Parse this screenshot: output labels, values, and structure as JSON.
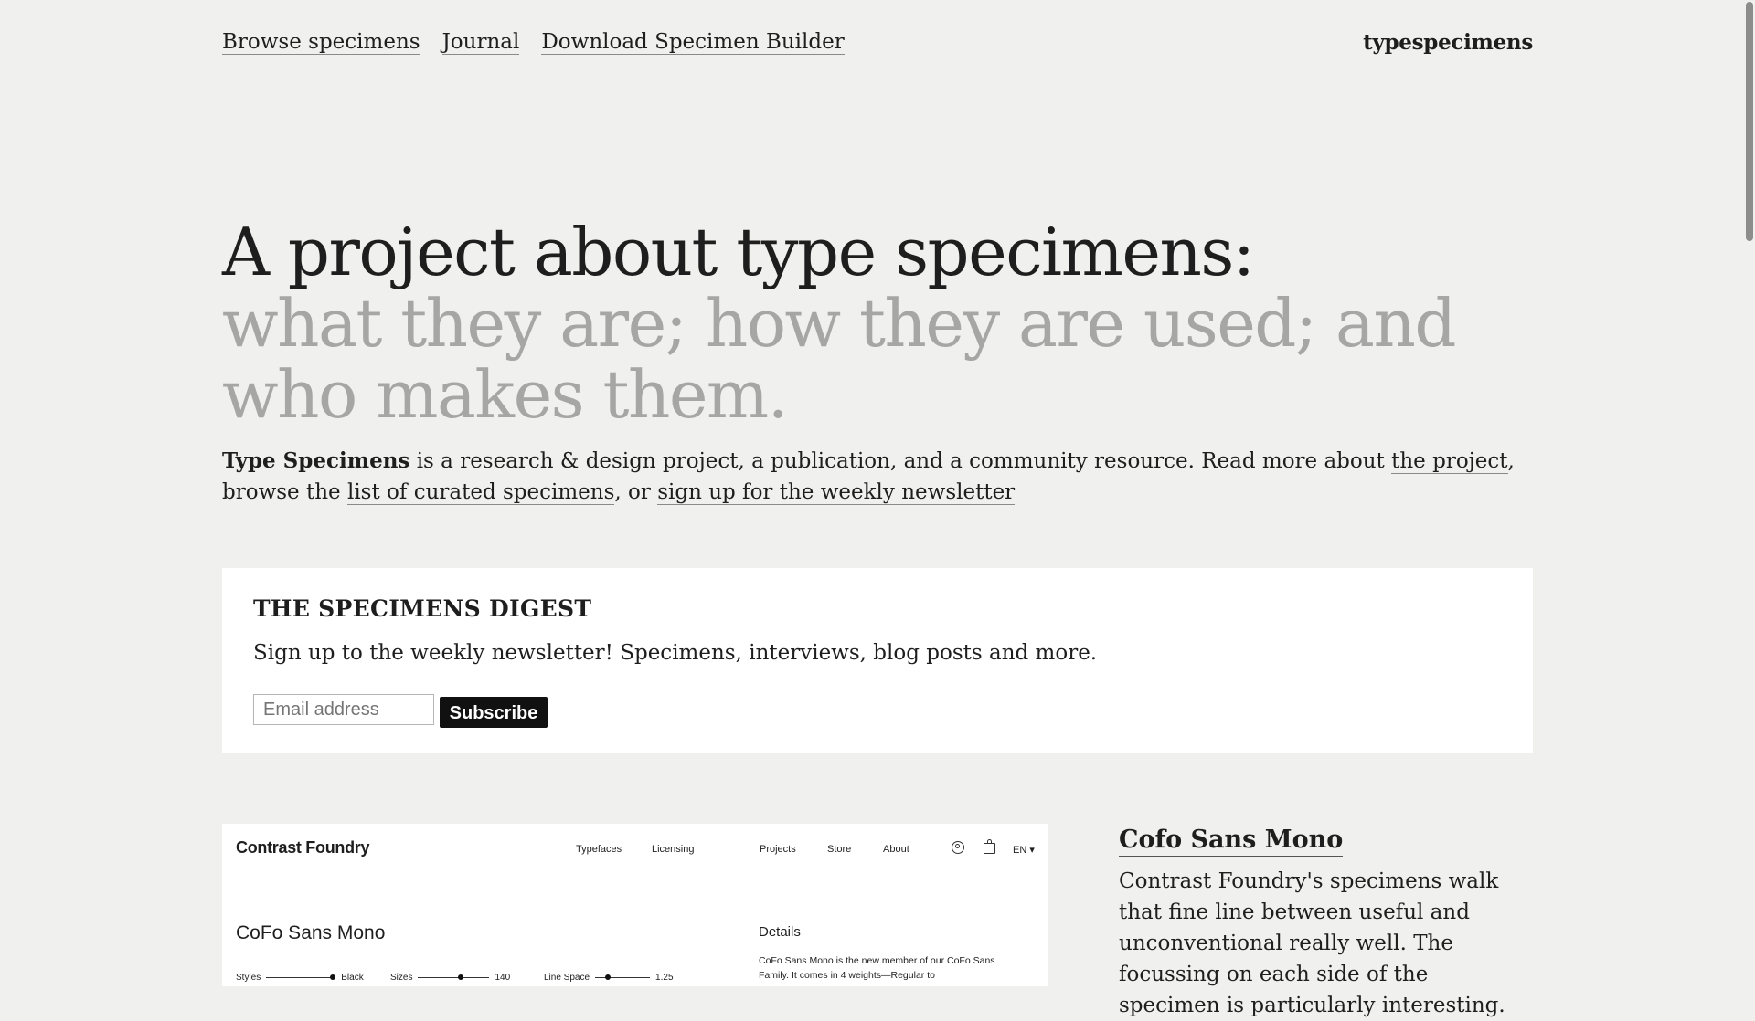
{
  "nav": {
    "links": [
      "Browse specimens",
      "Journal",
      "Download Specimen Builder"
    ],
    "brand": "typespecimens"
  },
  "hero": {
    "line1": "A project about type specimens:",
    "line2": "what they are; how they are used; and who makes them."
  },
  "intro": {
    "bold": "Type Specimens",
    "text1": " is a research & design project, a publication, and a community resource. Read more about ",
    "link1": "the project",
    "text2": ", browse the ",
    "link2": "list of curated specimens",
    "text3": ", or ",
    "link3": "sign up for the weekly newsletter"
  },
  "digest": {
    "title": "THE SPECIMENS DIGEST",
    "text": "Sign up to the weekly newsletter! Specimens, interviews, blog posts and more.",
    "email_placeholder": "Email address",
    "subscribe_label": "Subscribe"
  },
  "specimen": {
    "screenshot": {
      "logo": "Contrast Foundry",
      "menu": [
        "Typefaces",
        "Licensing",
        "Projects",
        "Store",
        "About"
      ],
      "lang": "EN",
      "font_name": "CoFo Sans Mono",
      "controls": [
        {
          "label": "Styles",
          "value": "Black",
          "level": 1.0
        },
        {
          "label": "Sizes",
          "value": "140",
          "level": 0.6
        },
        {
          "label": "Line Space",
          "value": "1.25",
          "level": 0.2
        }
      ],
      "details_title": "Details",
      "details_text": "CoFo Sans Mono is the new member of our CoFo Sans Family. It comes in 4 weights—Regular to"
    },
    "title": "Cofo Sans Mono",
    "description": "Contrast Foundry's specimens walk that fine line between useful and unconventional really well. The focussing on each side of the specimen is particularly interesting."
  },
  "icons": [
    "user-icon",
    "bag-icon",
    "caret-down-icon"
  ]
}
